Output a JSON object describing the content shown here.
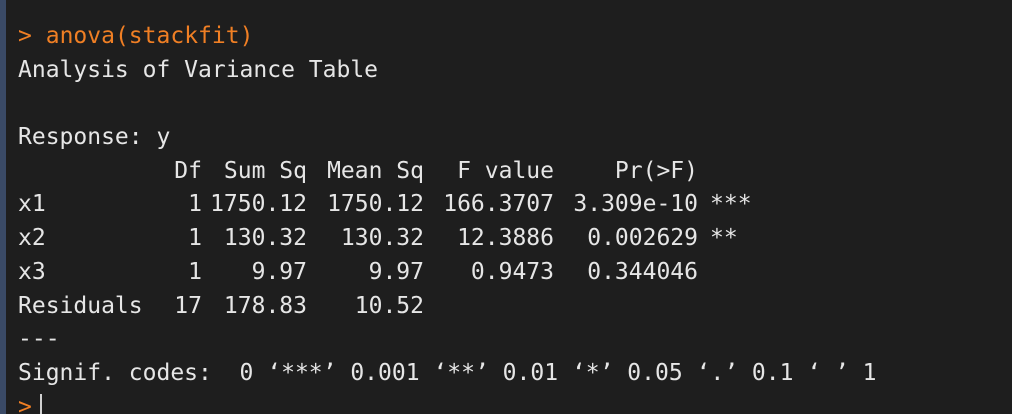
{
  "colors": {
    "background": "#1e1e1e",
    "text": "#e6e6e6",
    "command": "#f07f24",
    "left_bar": "#3a4a66"
  },
  "command": {
    "prompt": ">",
    "text": "anova(stackfit)"
  },
  "title": "Analysis of Variance Table",
  "response": "Response: y",
  "table": {
    "headers": [
      "Df",
      "Sum Sq",
      "Mean Sq",
      "F value",
      "Pr(>F)"
    ],
    "rows": [
      {
        "name": "x1",
        "df": "1",
        "sumsq": "1750.12",
        "meansq": "1750.12",
        "fvalue": "166.3707",
        "pr": "3.309e-10",
        "signif": "***"
      },
      {
        "name": "x2",
        "df": "1",
        "sumsq": "130.32",
        "meansq": "130.32",
        "fvalue": "12.3886",
        "pr": "0.002629",
        "signif": "**"
      },
      {
        "name": "x3",
        "df": "1",
        "sumsq": "9.97",
        "meansq": "9.97",
        "fvalue": "0.9473",
        "pr": "0.344046",
        "signif": ""
      },
      {
        "name": "Residuals",
        "df": "17",
        "sumsq": "178.83",
        "meansq": "10.52",
        "fvalue": "",
        "pr": "",
        "signif": ""
      }
    ]
  },
  "separator": "---",
  "signif_codes": "Signif. codes:  0 ‘***’ 0.001 ‘**’ 0.01 ‘*’ 0.05 ‘.’ 0.1 ‘ ’ 1",
  "next_prompt": ">"
}
